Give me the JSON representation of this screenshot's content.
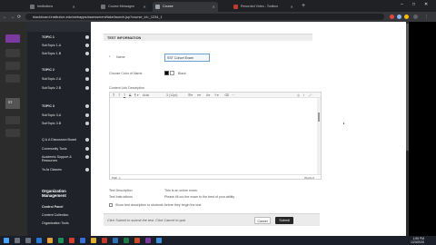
{
  "browser": {
    "tabs": [
      {
        "label": "Institutions",
        "active": false
      },
      {
        "label": "Course Messages",
        "active": false
      },
      {
        "label": "Course",
        "active": true
      },
      {
        "label": "Recorded Video - Toolbox",
        "active": false
      }
    ],
    "new_tab": "+",
    "window_controls": {
      "minimize": "–",
      "maximize": "□",
      "close": "✕"
    },
    "nav": {
      "back": "←",
      "forward": "→",
      "reload": "⟳"
    },
    "url": "blackboard.institution.edu/webapps/assessment/take/launch.jsp?course_id=_1234_1"
  },
  "left_rail": {
    "label": "ST"
  },
  "course_menu": {
    "items": [
      {
        "label": "TOPIC 1",
        "type": "topic"
      },
      {
        "label": "SubTopic 1.A",
        "type": "sub"
      },
      {
        "label": "SubTopic 1.B",
        "type": "sub"
      },
      {
        "label": "TOPIC 2",
        "type": "topic"
      },
      {
        "label": "SubTopic 2.A",
        "type": "sub"
      },
      {
        "label": "SubTopic 2.B",
        "type": "sub"
      },
      {
        "label": "TOPIC 3",
        "type": "topic"
      },
      {
        "label": "SubTopic 3.A",
        "type": "sub"
      },
      {
        "label": "SubTopic 3.B",
        "type": "sub"
      },
      {
        "label": "Q & A Discussion Board",
        "type": "link"
      },
      {
        "label": "Community Tools",
        "type": "link"
      },
      {
        "label": "Academic Support & Resources",
        "type": "link"
      },
      {
        "label": "YuJa Classes",
        "type": "link"
      }
    ],
    "org": {
      "title": "Organization Management",
      "items": [
        "Control Panel",
        "Content Collection",
        "Organization Tools"
      ]
    }
  },
  "form": {
    "section_title": "TEST INFORMATION",
    "name_label": "Name",
    "name_value": "SST Cohort Exam",
    "color_label": "Choose Color of Name",
    "color_value": "Black",
    "description_label": "Content Link Description",
    "toolbar": {
      "format": "Arial",
      "size": "3 (12pt)"
    },
    "status_left": "Path: p",
    "status_right": "Words:0",
    "test_description_label": "Test Description",
    "test_description_value": "This is an online exam.",
    "show_instructions_label": "Show test description to students before they begin the test.",
    "instructions_label": "Test Instructions",
    "instructions_value": "Please fill out the exam to the best of your ability.",
    "footer_note": "Click Submit to submit the test. Click Cancel to quit.",
    "cancel_label": "Cancel",
    "submit_label": "Submit"
  },
  "taskbar": {
    "time": "1:55 PM",
    "date": "1/23/2020"
  },
  "colors": {
    "course_purple": "#7b3aa0",
    "submit": "#262626",
    "name_highlight": "#6a9fd4"
  }
}
